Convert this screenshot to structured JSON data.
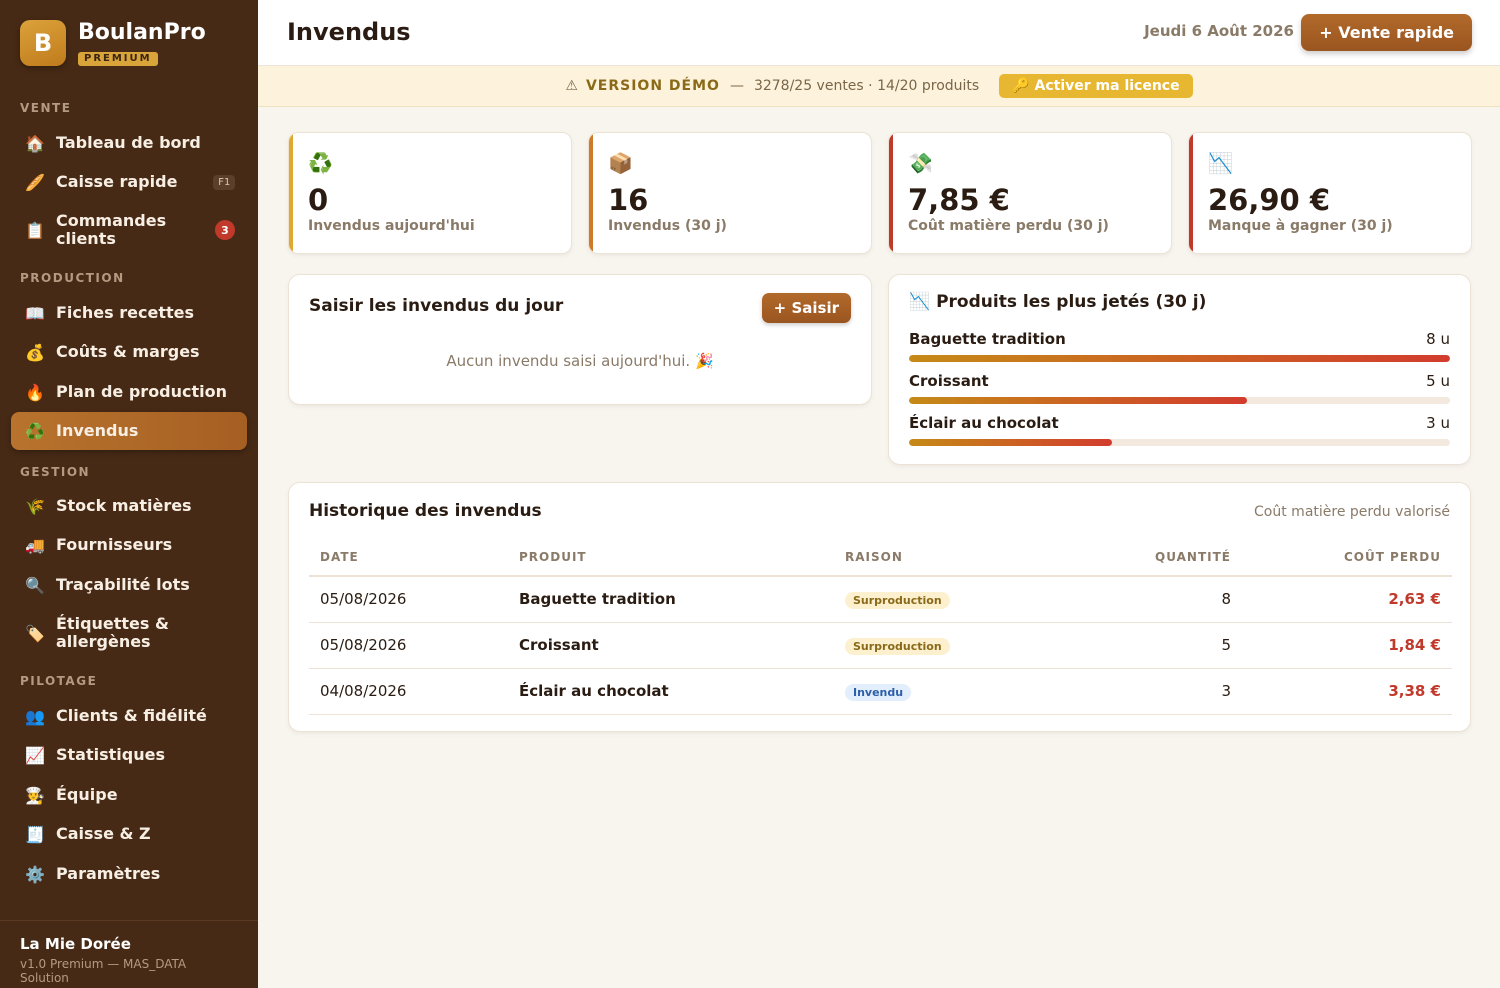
{
  "app": {
    "logo_letter": "B",
    "name": "BoulanPro",
    "badge": "PREMIUM"
  },
  "sidebar": {
    "sections": [
      {
        "title": "VENTE",
        "items": [
          {
            "icon": "house-icon",
            "glyph": "🏠",
            "label": "Tableau de bord"
          },
          {
            "icon": "baguette-icon",
            "glyph": "🥖",
            "label": "Caisse rapide",
            "shortcut": "F1"
          },
          {
            "icon": "clipboard-icon",
            "glyph": "📋",
            "label": "Commandes clients",
            "count": "3"
          }
        ]
      },
      {
        "title": "PRODUCTION",
        "items": [
          {
            "icon": "book-icon",
            "glyph": "📖",
            "label": "Fiches recettes"
          },
          {
            "icon": "money-bag-icon",
            "glyph": "💰",
            "label": "Coûts & marges"
          },
          {
            "icon": "fire-icon",
            "glyph": "🔥",
            "label": "Plan de production"
          },
          {
            "icon": "recycle-icon",
            "glyph": "♻️",
            "label": "Invendus",
            "active": true
          }
        ]
      },
      {
        "title": "GESTION",
        "items": [
          {
            "icon": "wheat-icon",
            "glyph": "🌾",
            "label": "Stock matières"
          },
          {
            "icon": "truck-icon",
            "glyph": "🚚",
            "label": "Fournisseurs"
          },
          {
            "icon": "magnifier-icon",
            "glyph": "🔍",
            "label": "Traçabilité lots"
          },
          {
            "icon": "label-icon",
            "glyph": "🏷️",
            "label": "Étiquettes & allergènes"
          }
        ]
      },
      {
        "title": "PILOTAGE",
        "items": [
          {
            "icon": "people-icon",
            "glyph": "👥",
            "label": "Clients & fidélité"
          },
          {
            "icon": "chart-up-icon",
            "glyph": "📈",
            "label": "Statistiques"
          },
          {
            "icon": "cook-icon",
            "glyph": "🧑‍🍳",
            "label": "Équipe"
          },
          {
            "icon": "receipt-icon",
            "glyph": "🧾",
            "label": "Caisse & Z"
          },
          {
            "icon": "gear-icon",
            "glyph": "⚙️",
            "label": "Paramètres"
          }
        ]
      }
    ],
    "footer": {
      "shop_name": "La Mie Dorée",
      "version": "v1.0 Premium — MAS_DATA Solution"
    }
  },
  "header": {
    "title": "Invendus",
    "date": "Jeudi 6 Août 2026",
    "quick_sale": "+ Vente rapide"
  },
  "banner": {
    "icon": "⚠",
    "label": "VERSION DÉMO",
    "sep": "—",
    "usage": "3278/25 ventes · 14/20 produits",
    "button": "🔑 Activer ma licence"
  },
  "kpis": [
    {
      "glyph": "♻️",
      "value": "0",
      "label": "Invendus aujourd'hui",
      "accent": "#e0a82e"
    },
    {
      "glyph": "📦",
      "value": "16",
      "label": "Invendus (30 j)",
      "accent": "#cf7a2a"
    },
    {
      "glyph": "💸",
      "value": "7,85 €",
      "label": "Coût matière perdu (30 j)",
      "accent": "#c0392b"
    },
    {
      "glyph": "📉",
      "value": "26,90 €",
      "label": "Manque à gagner (30 j)",
      "accent": "#c0392b"
    }
  ],
  "entry_panel": {
    "title": "Saisir les invendus du jour",
    "button": "+ Saisir",
    "empty": "Aucun invendu saisi aujourd'hui. 🎉"
  },
  "top_panel": {
    "glyph": "📉",
    "title": "Produits les plus jetés (30 j)",
    "items": [
      {
        "name": "Baguette tradition",
        "qty": "8 u",
        "value": 8
      },
      {
        "name": "Croissant",
        "qty": "5 u",
        "value": 5
      },
      {
        "name": "Éclair au chocolat",
        "qty": "3 u",
        "value": 3
      }
    ]
  },
  "history": {
    "title": "Historique des invendus",
    "subtitle": "Coût matière perdu valorisé",
    "columns": [
      "DATE",
      "PRODUIT",
      "RAISON",
      "QUANTITÉ",
      "COÛT PERDU"
    ],
    "rows": [
      {
        "date": "05/08/2026",
        "product": "Baguette tradition",
        "reason": "Surproduction",
        "reason_type": "surp",
        "qty": "8",
        "cost": "2,63 €"
      },
      {
        "date": "05/08/2026",
        "product": "Croissant",
        "reason": "Surproduction",
        "reason_type": "surp",
        "qty": "5",
        "cost": "1,84 €"
      },
      {
        "date": "04/08/2026",
        "product": "Éclair au chocolat",
        "reason": "Invendu",
        "reason_type": "inv",
        "qty": "3",
        "cost": "3,38 €"
      }
    ]
  }
}
